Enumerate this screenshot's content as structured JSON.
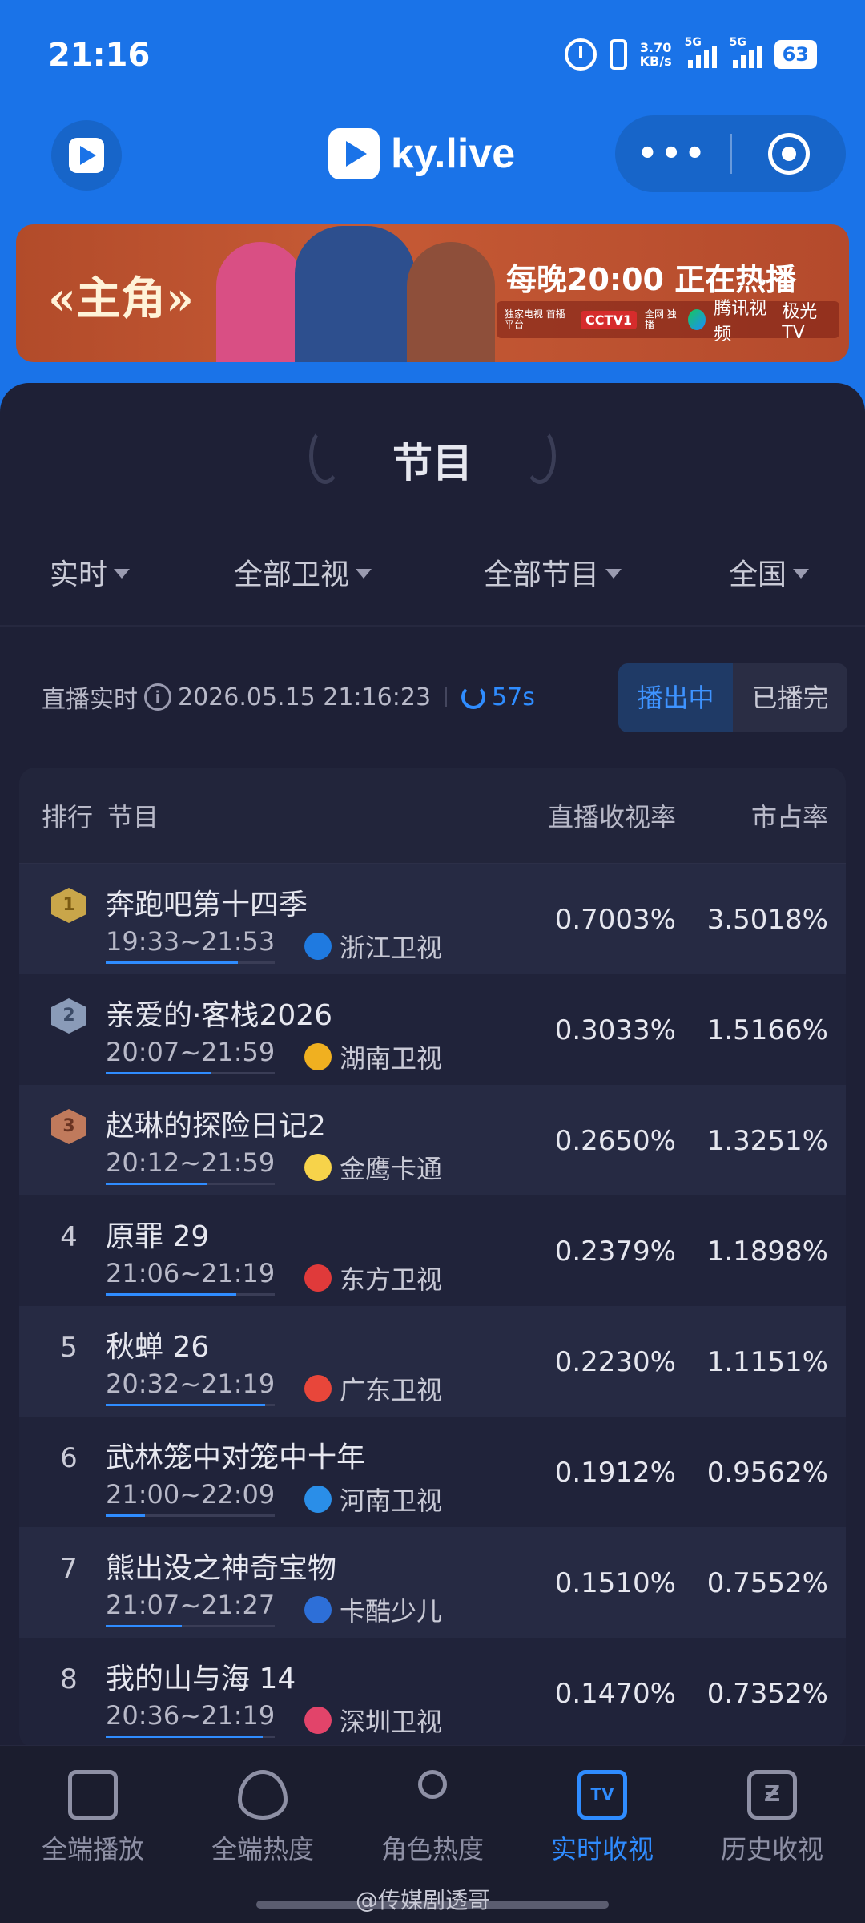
{
  "status": {
    "time": "21:16",
    "speed_top": "3.70",
    "speed_unit": "KB/s",
    "sig1_label": "5G",
    "sig2_label": "5G",
    "battery": "63"
  },
  "nav": {
    "brand": "ky.live",
    "more_label": "•••"
  },
  "banner": {
    "title": "«主角»",
    "slogan": "每晚20:00 正在热播",
    "sponsor_note": "独家电视 首播平台",
    "cctv_label": "CCTV1",
    "online_note": "全网 独播",
    "tencent_label": "腾讯视频",
    "jiguang_label": "极光TV"
  },
  "section": {
    "title": "节目"
  },
  "filters": [
    {
      "label": "实时"
    },
    {
      "label": "全部卫视"
    },
    {
      "label": "全部节目"
    },
    {
      "label": "全国"
    }
  ],
  "live": {
    "label": "直播实时",
    "info": "i",
    "datetime": "2026.05.15 21:16:23",
    "seconds": "57s"
  },
  "toggle": {
    "on_air": "播出中",
    "finished": "已播完"
  },
  "table": {
    "headers": {
      "rank": "排行",
      "program": "节目",
      "rating": "直播收视率",
      "share": "市占率"
    },
    "rows": [
      {
        "rank": "1",
        "name": "奔跑吧第十四季",
        "time": "19:33~21:53",
        "channel": "浙江卫视",
        "rating": "0.7003%",
        "share": "3.5018%",
        "progress": 0.78
      },
      {
        "rank": "2",
        "name": "亲爱的·客栈2026",
        "time": "20:07~21:59",
        "channel": "湖南卫视",
        "rating": "0.3033%",
        "share": "1.5166%",
        "progress": 0.62
      },
      {
        "rank": "3",
        "name": "赵琳的探险日记2",
        "time": "20:12~21:59",
        "channel": "金鹰卡通",
        "rating": "0.2650%",
        "share": "1.3251%",
        "progress": 0.6
      },
      {
        "rank": "4",
        "name": "原罪 29",
        "time": "21:06~21:19",
        "channel": "东方卫视",
        "rating": "0.2379%",
        "share": "1.1898%",
        "progress": 0.77
      },
      {
        "rank": "5",
        "name": "秋蝉 26",
        "time": "20:32~21:19",
        "channel": "广东卫视",
        "rating": "0.2230%",
        "share": "1.1151%",
        "progress": 0.94
      },
      {
        "rank": "6",
        "name": "武林笼中对笼中十年",
        "time": "21:00~22:09",
        "channel": "河南卫视",
        "rating": "0.1912%",
        "share": "0.9562%",
        "progress": 0.23
      },
      {
        "rank": "7",
        "name": "熊出没之神奇宝物",
        "time": "21:07~21:27",
        "channel": "卡酷少儿",
        "rating": "0.1510%",
        "share": "0.7552%",
        "progress": 0.45
      },
      {
        "rank": "8",
        "name": "我的山与海 14",
        "time": "20:36~21:19",
        "channel": "深圳卫视",
        "rating": "0.1470%",
        "share": "0.7352%",
        "progress": 0.93
      }
    ]
  },
  "tabs": [
    {
      "label": "全端播放",
      "icon": "play-box-icon"
    },
    {
      "label": "全端热度",
      "icon": "flame-icon"
    },
    {
      "label": "角色热度",
      "icon": "user-icon"
    },
    {
      "label": "实时收视",
      "icon": "tv-icon",
      "active": true
    },
    {
      "label": "历史收视",
      "icon": "history-icon"
    }
  ],
  "watermark": "@传媒剧透哥",
  "colors": {
    "brand_blue": "#1a73e8",
    "accent": "#2f8cff",
    "bg_dark": "#1e2036",
    "gold": "#c9a64a",
    "silver": "#8a9bb8",
    "bronze": "#c07a5c"
  },
  "channel_colors": {
    "浙江卫视": "#1f7ae0",
    "湖南卫视": "#f0b020",
    "金鹰卡通": "#f7d34a",
    "东方卫视": "#e03a3a",
    "广东卫视": "#e8463a",
    "河南卫视": "#2a8ee8",
    "卡酷少儿": "#2d6fd8",
    "深圳卫视": "#e2446a"
  }
}
